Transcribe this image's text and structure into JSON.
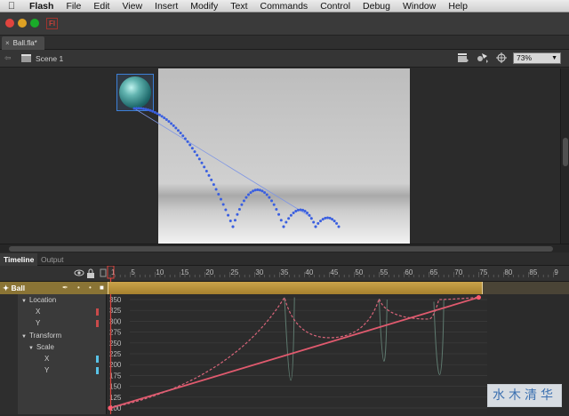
{
  "menubar": {
    "apple": "",
    "items": [
      "Flash",
      "File",
      "Edit",
      "View",
      "Insert",
      "Modify",
      "Text",
      "Commands",
      "Control",
      "Debug",
      "Window",
      "Help"
    ]
  },
  "app": {
    "badge": "Fl"
  },
  "document": {
    "tab_label": "Ball.fla*",
    "close": "×"
  },
  "scene": {
    "back": "⇦",
    "name": "Scene 1"
  },
  "zoom": {
    "value": "73%",
    "arrow": "▼"
  },
  "panels": {
    "timeline": "Timeline",
    "output": "Output"
  },
  "timeline": {
    "ruler_labels": [
      "1",
      "5",
      "10",
      "15",
      "20",
      "25",
      "30",
      "35",
      "40",
      "45",
      "50",
      "55",
      "60",
      "65",
      "70",
      "75",
      "80",
      "85",
      "9"
    ],
    "ruler_first_frame": 1,
    "ruler_last_visible_frame": 90,
    "current_frame": 1,
    "layer": {
      "name": "Ball",
      "first_frame": 1,
      "last_frame": 75
    }
  },
  "motion_editor": {
    "properties": [
      {
        "label": "Location",
        "type": "group"
      },
      {
        "label": "X",
        "type": "prop",
        "color": "#c94a4a"
      },
      {
        "label": "Y",
        "type": "prop",
        "color": "#c94a4a"
      },
      {
        "label": "Transform",
        "type": "group"
      },
      {
        "label": "Scale",
        "type": "group"
      },
      {
        "label": "X",
        "type": "prop",
        "color": "#59c3e8"
      },
      {
        "label": "Y",
        "type": "prop",
        "color": "#59c3e8"
      }
    ],
    "y_axis": {
      "labels": [
        "350",
        "325",
        "300",
        "275",
        "250",
        "225",
        "200",
        "175",
        "150",
        "125",
        "100"
      ],
      "min": 100,
      "max": 350
    },
    "curves": {
      "x_linear": {
        "color": "#e05a6e",
        "points": [
          [
            1,
            100
          ],
          [
            75,
            355
          ]
        ]
      },
      "y_bounce": {
        "color": "#d9657a",
        "points": [
          [
            1,
            100
          ],
          [
            36,
            355
          ],
          [
            45,
            262
          ],
          [
            55,
            352
          ],
          [
            65,
            305
          ],
          [
            67,
            350
          ],
          [
            75,
            355
          ]
        ]
      }
    }
  },
  "stage": {
    "ball_color": "#2f7f80",
    "path_color": "#3a5fe0"
  },
  "watermark": {
    "text": "水木清华"
  }
}
